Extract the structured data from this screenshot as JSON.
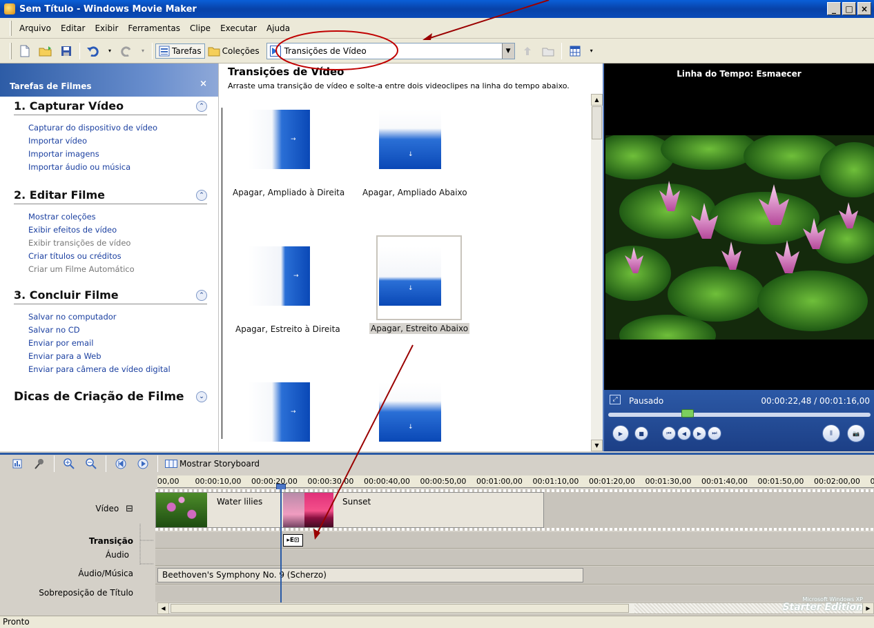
{
  "window": {
    "title": "Sem Título - Windows Movie Maker",
    "min": "_",
    "max": "□",
    "close": "×"
  },
  "menu": [
    "Arquivo",
    "Editar",
    "Exibir",
    "Ferramentas",
    "Clipe",
    "Executar",
    "Ajuda"
  ],
  "toolbar": {
    "tasks_label": "Tarefas",
    "collections_label": "Coleções",
    "combo_value": "Transições de Vídeo"
  },
  "taskpane": {
    "title": "Tarefas de Filmes",
    "close": "×",
    "sections": [
      {
        "title": "1. Capturar Vídeo",
        "links": [
          "Capturar do dispositivo de vídeo",
          "Importar vídeo",
          "Importar imagens",
          "Importar áudio ou música"
        ]
      },
      {
        "title": "2. Editar Filme",
        "links": [
          "Mostrar coleções",
          "Exibir efeitos de vídeo",
          "Exibir transições de vídeo",
          "Criar títulos ou créditos",
          "Criar um Filme Automático"
        ]
      },
      {
        "title": "3. Concluir Filme",
        "links": [
          "Salvar no computador",
          "Salvar no CD",
          "Enviar por email",
          "Enviar para a Web",
          "Enviar para câmera de vídeo digital"
        ]
      },
      {
        "title": "Dicas de Criação de Filme",
        "links": []
      }
    ]
  },
  "content": {
    "title": "Transições de Vídeo",
    "subtitle": "Arraste uma transição de vídeo e solte-a entre dois videoclipes na linha do tempo abaixo.",
    "transitions": [
      "Apagar, Ampliado à Direita",
      "Apagar, Ampliado Abaixo",
      "Apagar, Estreito à Direita",
      "Apagar, Estreito Abaixo"
    ]
  },
  "monitor": {
    "title": "Linha do Tempo: Esmaecer",
    "state": "Pausado",
    "timecode": "00:00:22,48 / 00:01:16,00"
  },
  "timeline": {
    "show_storyboard": "Mostrar Storyboard",
    "ruler": [
      "00,00",
      "00:00:10,00",
      "00:00:20,00",
      "00:00:30,00",
      "00:00:40,00",
      "00:00:50,00",
      "00:01:00,00",
      "00:01:10,00",
      "00:01:20,00",
      "00:01:30,00",
      "00:01:40,00",
      "00:01:50,00",
      "00:02:00,00",
      "00:0"
    ],
    "tracks": {
      "video": "Vídeo",
      "video_toggle": "⊟",
      "transition": "Transição",
      "audio": "Áudio",
      "music": "Áudio/Música",
      "title_overlay": "Sobreposição de Título"
    },
    "clips": {
      "clip1": "Water lilies",
      "clip2": "Sunset",
      "music": "Beethoven's Symphony No. 9 (Scherzo)"
    },
    "watermark_line1": "Microsoft Windows XP",
    "watermark_line2": "Starter Edition"
  },
  "status": "Pronto",
  "colors": {
    "accent": "#0a48b6",
    "link": "#1a3fa0",
    "titlebar": "#0842a8"
  }
}
